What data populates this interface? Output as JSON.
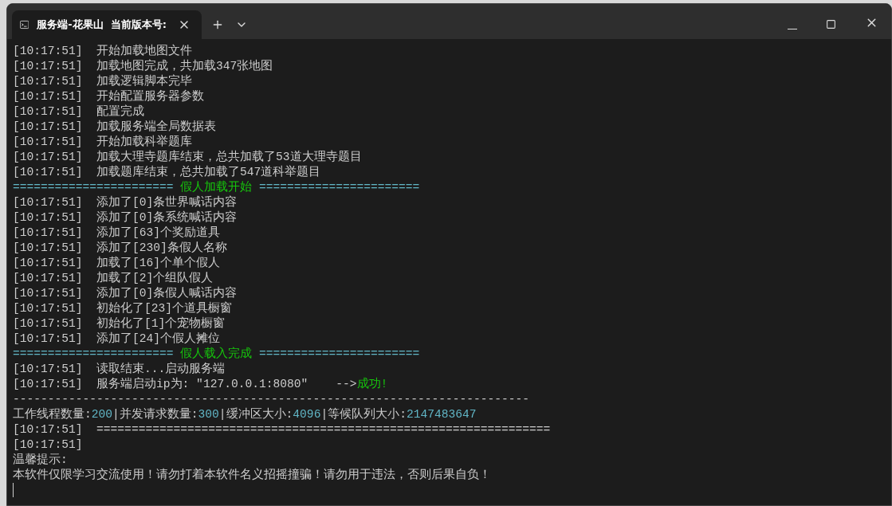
{
  "tab": {
    "title": "服务端-花果山  当前版本号:",
    "selected": true
  },
  "lines": [
    {
      "segments": [
        {
          "kind": "time",
          "text": "[10:17:51]"
        },
        {
          "kind": "normal",
          "text": "  开始加载地图文件"
        }
      ]
    },
    {
      "segments": [
        {
          "kind": "time",
          "text": "[10:17:51]"
        },
        {
          "kind": "normal",
          "text": "  加载地图完成，共加载347张地图"
        }
      ]
    },
    {
      "segments": [
        {
          "kind": "time",
          "text": "[10:17:51]"
        },
        {
          "kind": "normal",
          "text": "  加载逻辑脚本完毕"
        }
      ]
    },
    {
      "segments": [
        {
          "kind": "time",
          "text": "[10:17:51]"
        },
        {
          "kind": "normal",
          "text": "  开始配置服务器参数"
        }
      ]
    },
    {
      "segments": [
        {
          "kind": "time",
          "text": "[10:17:51]"
        },
        {
          "kind": "normal",
          "text": "  配置完成"
        }
      ]
    },
    {
      "segments": [
        {
          "kind": "time",
          "text": "[10:17:51]"
        },
        {
          "kind": "normal",
          "text": "  加载服务端全局数据表"
        }
      ]
    },
    {
      "segments": [
        {
          "kind": "time",
          "text": "[10:17:51]"
        },
        {
          "kind": "normal",
          "text": "  开始加载科举题库"
        }
      ]
    },
    {
      "segments": [
        {
          "kind": "time",
          "text": "[10:17:51]"
        },
        {
          "kind": "normal",
          "text": "  加载大理寺题库结束，总共加载了53道大理寺题目"
        }
      ]
    },
    {
      "segments": [
        {
          "kind": "time",
          "text": "[10:17:51]"
        },
        {
          "kind": "normal",
          "text": "  加载题库结束，总共加载了547道科举题目"
        }
      ]
    },
    {
      "segments": [
        {
          "kind": "cyan",
          "text": "======================= "
        },
        {
          "kind": "green",
          "text": "假人加载开始"
        },
        {
          "kind": "cyan",
          "text": " ======================="
        }
      ]
    },
    {
      "segments": [
        {
          "kind": "time",
          "text": "[10:17:51]"
        },
        {
          "kind": "normal",
          "text": "  添加了[0]条世界喊话内容"
        }
      ]
    },
    {
      "segments": [
        {
          "kind": "time",
          "text": "[10:17:51]"
        },
        {
          "kind": "normal",
          "text": "  添加了[0]条系统喊话内容"
        }
      ]
    },
    {
      "segments": [
        {
          "kind": "time",
          "text": "[10:17:51]"
        },
        {
          "kind": "normal",
          "text": "  添加了[63]个奖励道具"
        }
      ]
    },
    {
      "segments": [
        {
          "kind": "time",
          "text": "[10:17:51]"
        },
        {
          "kind": "normal",
          "text": "  添加了[230]条假人名称"
        }
      ]
    },
    {
      "segments": [
        {
          "kind": "time",
          "text": "[10:17:51]"
        },
        {
          "kind": "normal",
          "text": "  加载了[16]个单个假人"
        }
      ]
    },
    {
      "segments": [
        {
          "kind": "time",
          "text": "[10:17:51]"
        },
        {
          "kind": "normal",
          "text": "  加载了[2]个组队假人"
        }
      ]
    },
    {
      "segments": [
        {
          "kind": "time",
          "text": "[10:17:51]"
        },
        {
          "kind": "normal",
          "text": "  添加了[0]条假人喊话内容"
        }
      ]
    },
    {
      "segments": [
        {
          "kind": "time",
          "text": "[10:17:51]"
        },
        {
          "kind": "normal",
          "text": "  初始化了[23]个道具橱窗"
        }
      ]
    },
    {
      "segments": [
        {
          "kind": "time",
          "text": "[10:17:51]"
        },
        {
          "kind": "normal",
          "text": "  初始化了[1]个宠物橱窗"
        }
      ]
    },
    {
      "segments": [
        {
          "kind": "time",
          "text": "[10:17:51]"
        },
        {
          "kind": "normal",
          "text": "  添加了[24]个假人摊位"
        }
      ]
    },
    {
      "segments": [
        {
          "kind": "cyan",
          "text": "======================= "
        },
        {
          "kind": "green",
          "text": "假人载入完成"
        },
        {
          "kind": "cyan",
          "text": " ======================="
        }
      ]
    },
    {
      "segments": [
        {
          "kind": "time",
          "text": "[10:17:51]"
        },
        {
          "kind": "normal",
          "text": "  读取结束...启动服务端"
        }
      ]
    },
    {
      "segments": [
        {
          "kind": "time",
          "text": "[10:17:51]"
        },
        {
          "kind": "normal",
          "text": "  服务端启动ip为: \"127.0.0.1:8080\"    -->"
        },
        {
          "kind": "green",
          "text": "成功!"
        }
      ]
    },
    {
      "segments": [
        {
          "kind": "normal",
          "text": "--------------------------------------------------------------------------"
        }
      ]
    },
    {
      "segments": [
        {
          "kind": "normal",
          "text": "工作线程数量:"
        },
        {
          "kind": "cyan",
          "text": "200"
        },
        {
          "kind": "normal",
          "text": "|并发请求数量:"
        },
        {
          "kind": "cyan",
          "text": "300"
        },
        {
          "kind": "normal",
          "text": "|缓冲区大小:"
        },
        {
          "kind": "cyan",
          "text": "4096"
        },
        {
          "kind": "normal",
          "text": "|等候队列大小:"
        },
        {
          "kind": "cyan",
          "text": "2147483647"
        }
      ]
    },
    {
      "segments": [
        {
          "kind": "time",
          "text": "[10:17:51]"
        },
        {
          "kind": "normal",
          "text": "  ================================================================="
        }
      ]
    },
    {
      "segments": [
        {
          "kind": "time",
          "text": "[10:17:51]"
        }
      ]
    },
    {
      "segments": [
        {
          "kind": "normal",
          "text": "温馨提示:"
        }
      ]
    },
    {
      "segments": [
        {
          "kind": "normal",
          "text": "本软件仅限学习交流使用！请勿打着本软件名义招摇撞骗！请勿用于违法，否则后果自负！"
        }
      ]
    }
  ]
}
